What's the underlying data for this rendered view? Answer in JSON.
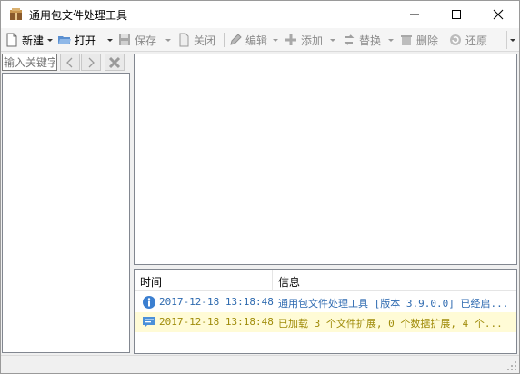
{
  "window": {
    "title": "通用包文件处理工具",
    "icon": "package-icon"
  },
  "toolbar": {
    "new_label": "新建",
    "open_label": "打开",
    "save_label": "保存",
    "close_label": "关闭",
    "edit_label": "编辑",
    "add_label": "添加",
    "replace_label": "替换",
    "delete_label": "删除",
    "restore_label": "还原"
  },
  "left_panel": {
    "search_placeholder": "输入关键字"
  },
  "log": {
    "columns": [
      "时间",
      "信息"
    ],
    "rows": [
      {
        "icon": "info-icon",
        "time": "2017-12-18 13:18:48",
        "message": "通用包文件处理工具 [版本 3.9.0.0] 已经启...",
        "color": "#2e6ab0",
        "background": "#ffffff"
      },
      {
        "icon": "message-icon",
        "time": "2017-12-18 13:18:48",
        "message": "已加载 3 个文件扩展, 0 个数据扩展, 4 个...",
        "color": "#a08c0a",
        "background": "#fffbd6"
      }
    ]
  },
  "colors": {
    "accent_blue": "#2e6ab0",
    "warn_yellow": "#a08c0a",
    "row_highlight": "#fffbd6"
  }
}
